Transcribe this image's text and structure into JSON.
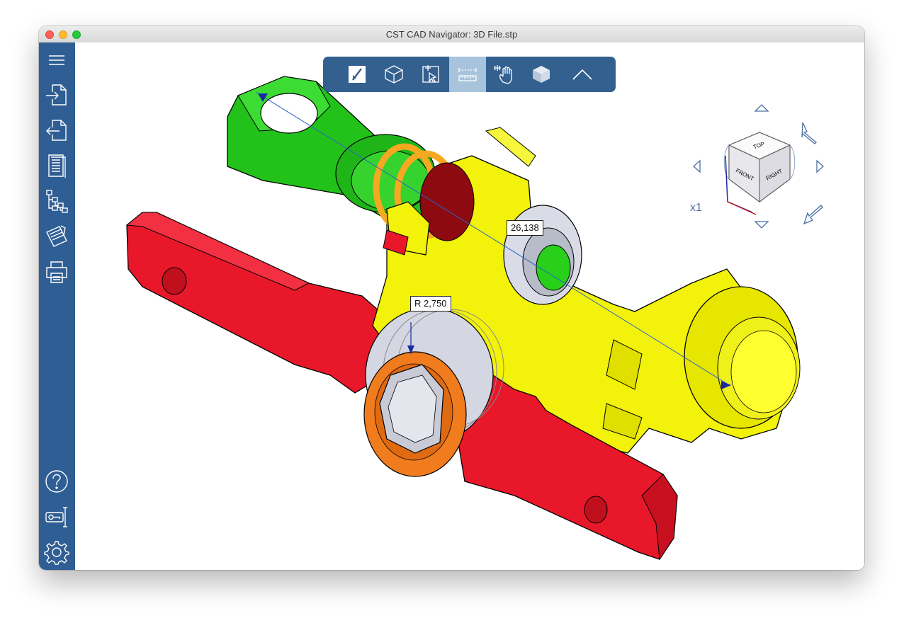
{
  "window": {
    "title": "CST CAD Navigator: 3D File.stp"
  },
  "sidebar": {
    "top_items": [
      "menu-icon",
      "import-icon",
      "export-icon",
      "document-icon",
      "tree-icon",
      "drawing-icon",
      "print-icon"
    ],
    "bottom_items": [
      "help-icon",
      "license-icon",
      "settings-icon"
    ]
  },
  "toolbar": {
    "buttons": [
      "select-tool",
      "3d-view",
      "pick-tool",
      "measure-tool",
      "pan-tool",
      "shaded-view",
      "collapse"
    ],
    "active": "measure-tool"
  },
  "annotations": {
    "distance_label": "26,138",
    "radius_label": "R 2,750"
  },
  "navcube": {
    "faces": {
      "top": "TOP",
      "front": "FRONT",
      "right": "RIGHT"
    },
    "zoom_label": "x1"
  },
  "colors": {
    "sidebar": "#2f5e94",
    "toolbar": "#33608f",
    "toolbar_active": "#a8c4dc",
    "part_red": "#e8182a",
    "part_yellow": "#f2f20a",
    "part_green": "#22c21a",
    "part_orange": "#f07c1e",
    "part_silver": "#cfd2dc"
  }
}
